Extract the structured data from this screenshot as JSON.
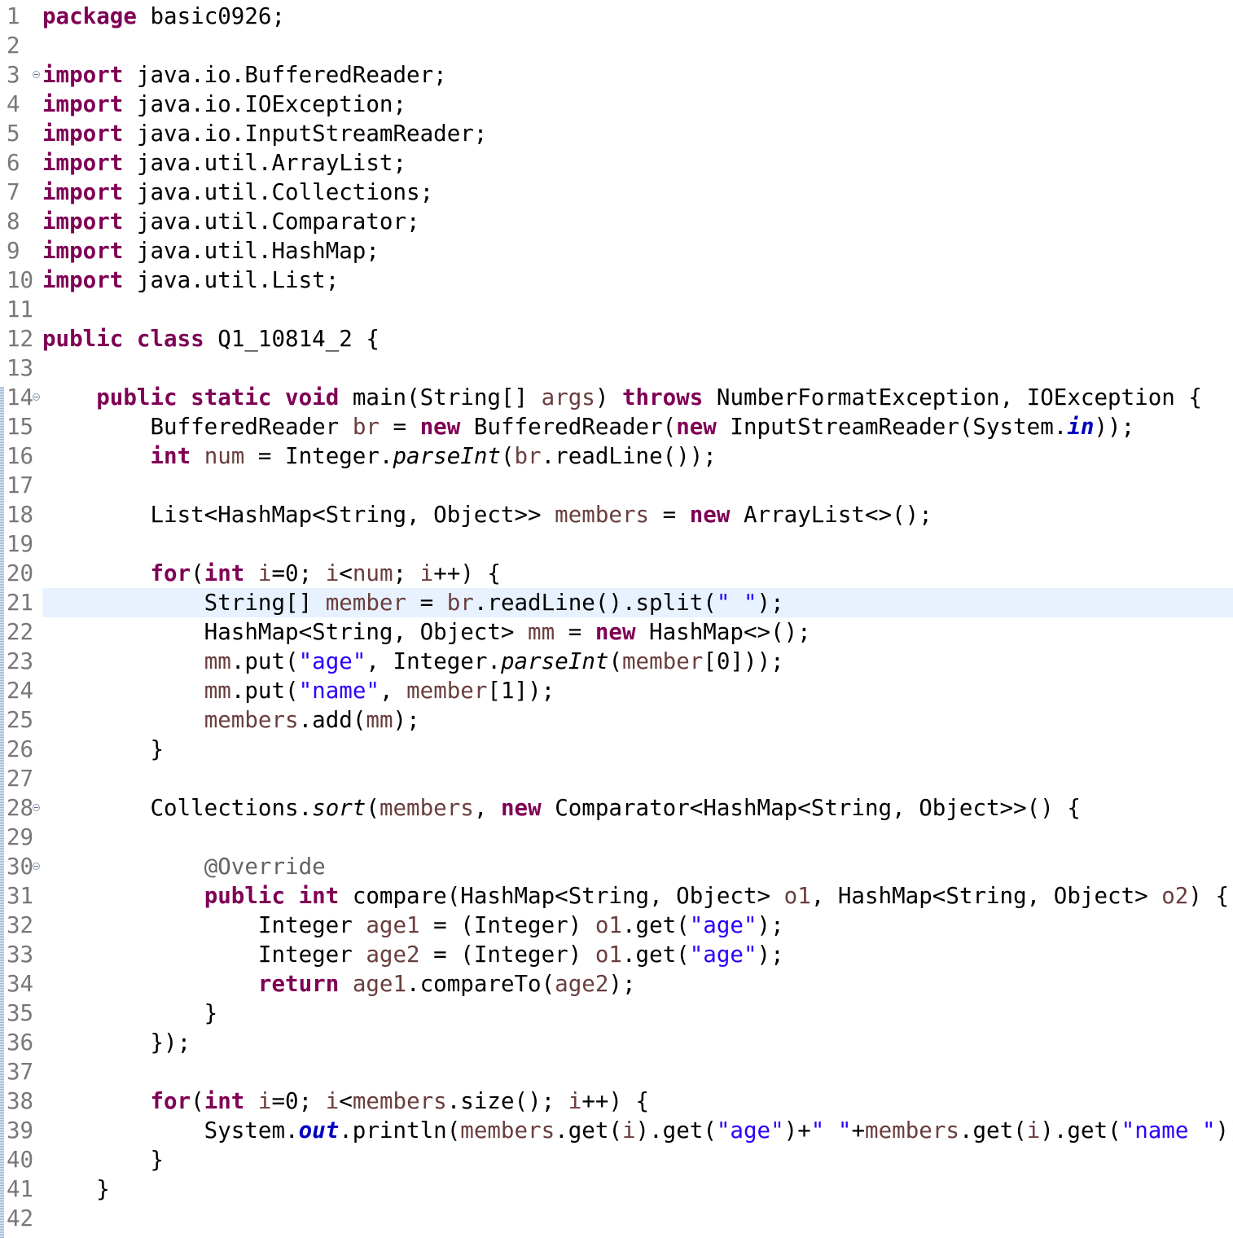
{
  "editor": {
    "current_line": 21,
    "lines": [
      {
        "n": "1",
        "fold": false,
        "tokens": [
          {
            "t": "package",
            "c": "kw"
          },
          {
            "t": " basic0926;"
          }
        ]
      },
      {
        "n": "2",
        "fold": false,
        "tokens": []
      },
      {
        "n": "3",
        "fold": true,
        "tokens": [
          {
            "t": "import",
            "c": "kw"
          },
          {
            "t": " java.io.BufferedReader;"
          }
        ]
      },
      {
        "n": "4",
        "fold": false,
        "tokens": [
          {
            "t": "import",
            "c": "kw"
          },
          {
            "t": " java.io.IOException;"
          }
        ]
      },
      {
        "n": "5",
        "fold": false,
        "tokens": [
          {
            "t": "import",
            "c": "kw"
          },
          {
            "t": " java.io.InputStreamReader;"
          }
        ]
      },
      {
        "n": "6",
        "fold": false,
        "tokens": [
          {
            "t": "import",
            "c": "kw"
          },
          {
            "t": " java.util.ArrayList;"
          }
        ]
      },
      {
        "n": "7",
        "fold": false,
        "tokens": [
          {
            "t": "import",
            "c": "kw"
          },
          {
            "t": " java.util.Collections;"
          }
        ]
      },
      {
        "n": "8",
        "fold": false,
        "tokens": [
          {
            "t": "import",
            "c": "kw"
          },
          {
            "t": " java.util.Comparator;"
          }
        ]
      },
      {
        "n": "9",
        "fold": false,
        "tokens": [
          {
            "t": "import",
            "c": "kw"
          },
          {
            "t": " java.util.HashMap;"
          }
        ]
      },
      {
        "n": "10",
        "fold": false,
        "tokens": [
          {
            "t": "import",
            "c": "kw"
          },
          {
            "t": " java.util.List;"
          }
        ]
      },
      {
        "n": "11",
        "fold": false,
        "tokens": []
      },
      {
        "n": "12",
        "fold": false,
        "tokens": [
          {
            "t": "public",
            "c": "kw"
          },
          {
            "t": " "
          },
          {
            "t": "class",
            "c": "kw"
          },
          {
            "t": " Q1_10814_2 {"
          }
        ]
      },
      {
        "n": "13",
        "fold": false,
        "tokens": []
      },
      {
        "n": "14",
        "fold": true,
        "tokens": [
          {
            "t": "    "
          },
          {
            "t": "public",
            "c": "kw"
          },
          {
            "t": " "
          },
          {
            "t": "static",
            "c": "kw"
          },
          {
            "t": " "
          },
          {
            "t": "void",
            "c": "kw"
          },
          {
            "t": " main(String[] "
          },
          {
            "t": "args",
            "c": "var"
          },
          {
            "t": ") "
          },
          {
            "t": "throws",
            "c": "kw"
          },
          {
            "t": " NumberFormatException, IOException {"
          }
        ]
      },
      {
        "n": "15",
        "fold": false,
        "tokens": [
          {
            "t": "        BufferedReader "
          },
          {
            "t": "br",
            "c": "var"
          },
          {
            "t": " = "
          },
          {
            "t": "new",
            "c": "kw"
          },
          {
            "t": " BufferedReader("
          },
          {
            "t": "new",
            "c": "kw"
          },
          {
            "t": " InputStreamReader(System."
          },
          {
            "t": "in",
            "c": "fld"
          },
          {
            "t": "));"
          }
        ]
      },
      {
        "n": "16",
        "fold": false,
        "tokens": [
          {
            "t": "        "
          },
          {
            "t": "int",
            "c": "kw"
          },
          {
            "t": " "
          },
          {
            "t": "num",
            "c": "var"
          },
          {
            "t": " = Integer."
          },
          {
            "t": "parseInt",
            "c": "it"
          },
          {
            "t": "("
          },
          {
            "t": "br",
            "c": "var"
          },
          {
            "t": ".readLine());"
          }
        ]
      },
      {
        "n": "17",
        "fold": false,
        "tokens": []
      },
      {
        "n": "18",
        "fold": false,
        "tokens": [
          {
            "t": "        List<HashMap<String, Object>> "
          },
          {
            "t": "members",
            "c": "var"
          },
          {
            "t": " = "
          },
          {
            "t": "new",
            "c": "kw"
          },
          {
            "t": " ArrayList<>();"
          }
        ]
      },
      {
        "n": "19",
        "fold": false,
        "tokens": []
      },
      {
        "n": "20",
        "fold": false,
        "tokens": [
          {
            "t": "        "
          },
          {
            "t": "for",
            "c": "kw"
          },
          {
            "t": "("
          },
          {
            "t": "int",
            "c": "kw"
          },
          {
            "t": " "
          },
          {
            "t": "i",
            "c": "var"
          },
          {
            "t": "=0; "
          },
          {
            "t": "i",
            "c": "var"
          },
          {
            "t": "<"
          },
          {
            "t": "num",
            "c": "var"
          },
          {
            "t": "; "
          },
          {
            "t": "i",
            "c": "var"
          },
          {
            "t": "++) {"
          }
        ]
      },
      {
        "n": "21",
        "fold": false,
        "tokens": [
          {
            "t": "            String[] "
          },
          {
            "t": "member",
            "c": "var"
          },
          {
            "t": " = "
          },
          {
            "t": "br",
            "c": "var"
          },
          {
            "t": ".readLine().split("
          },
          {
            "t": "\" \"",
            "c": "str"
          },
          {
            "t": ");"
          }
        ]
      },
      {
        "n": "22",
        "fold": false,
        "tokens": [
          {
            "t": "            HashMap<String, Object> "
          },
          {
            "t": "mm",
            "c": "var"
          },
          {
            "t": " = "
          },
          {
            "t": "new",
            "c": "kw"
          },
          {
            "t": " HashMap<>();"
          }
        ]
      },
      {
        "n": "23",
        "fold": false,
        "tokens": [
          {
            "t": "            "
          },
          {
            "t": "mm",
            "c": "var"
          },
          {
            "t": ".put("
          },
          {
            "t": "\"age\"",
            "c": "str"
          },
          {
            "t": ", Integer."
          },
          {
            "t": "parseInt",
            "c": "it"
          },
          {
            "t": "("
          },
          {
            "t": "member",
            "c": "var"
          },
          {
            "t": "[0]));"
          }
        ]
      },
      {
        "n": "24",
        "fold": false,
        "tokens": [
          {
            "t": "            "
          },
          {
            "t": "mm",
            "c": "var"
          },
          {
            "t": ".put("
          },
          {
            "t": "\"name\"",
            "c": "str"
          },
          {
            "t": ", "
          },
          {
            "t": "member",
            "c": "var"
          },
          {
            "t": "[1]);"
          }
        ]
      },
      {
        "n": "25",
        "fold": false,
        "tokens": [
          {
            "t": "            "
          },
          {
            "t": "members",
            "c": "var"
          },
          {
            "t": ".add("
          },
          {
            "t": "mm",
            "c": "var"
          },
          {
            "t": ");"
          }
        ]
      },
      {
        "n": "26",
        "fold": false,
        "tokens": [
          {
            "t": "        }"
          }
        ]
      },
      {
        "n": "27",
        "fold": false,
        "tokens": []
      },
      {
        "n": "28",
        "fold": true,
        "tokens": [
          {
            "t": "        Collections."
          },
          {
            "t": "sort",
            "c": "it"
          },
          {
            "t": "("
          },
          {
            "t": "members",
            "c": "var"
          },
          {
            "t": ", "
          },
          {
            "t": "new",
            "c": "kw"
          },
          {
            "t": " Comparator<HashMap<String, Object>>() {"
          }
        ]
      },
      {
        "n": "29",
        "fold": false,
        "tokens": []
      },
      {
        "n": "30",
        "fold": true,
        "tokens": [
          {
            "t": "            "
          },
          {
            "t": "@Override",
            "c": "ann"
          }
        ]
      },
      {
        "n": "31",
        "fold": false,
        "tokens": [
          {
            "t": "            "
          },
          {
            "t": "public",
            "c": "kw"
          },
          {
            "t": " "
          },
          {
            "t": "int",
            "c": "kw"
          },
          {
            "t": " compare(HashMap<String, Object> "
          },
          {
            "t": "o1",
            "c": "var"
          },
          {
            "t": ", HashMap<String, Object> "
          },
          {
            "t": "o2",
            "c": "var"
          },
          {
            "t": ") {"
          }
        ]
      },
      {
        "n": "32",
        "fold": false,
        "tokens": [
          {
            "t": "                Integer "
          },
          {
            "t": "age1",
            "c": "var"
          },
          {
            "t": " = (Integer) "
          },
          {
            "t": "o1",
            "c": "var"
          },
          {
            "t": ".get("
          },
          {
            "t": "\"age\"",
            "c": "str"
          },
          {
            "t": ");"
          }
        ]
      },
      {
        "n": "33",
        "fold": false,
        "tokens": [
          {
            "t": "                Integer "
          },
          {
            "t": "age2",
            "c": "var"
          },
          {
            "t": " = (Integer) "
          },
          {
            "t": "o1",
            "c": "var"
          },
          {
            "t": ".get("
          },
          {
            "t": "\"age\"",
            "c": "str"
          },
          {
            "t": ");"
          }
        ]
      },
      {
        "n": "34",
        "fold": false,
        "tokens": [
          {
            "t": "                "
          },
          {
            "t": "return",
            "c": "kw"
          },
          {
            "t": " "
          },
          {
            "t": "age1",
            "c": "var"
          },
          {
            "t": ".compareTo("
          },
          {
            "t": "age2",
            "c": "var"
          },
          {
            "t": ");"
          }
        ]
      },
      {
        "n": "35",
        "fold": false,
        "tokens": [
          {
            "t": "            }"
          }
        ]
      },
      {
        "n": "36",
        "fold": false,
        "tokens": [
          {
            "t": "        });"
          }
        ]
      },
      {
        "n": "37",
        "fold": false,
        "tokens": []
      },
      {
        "n": "38",
        "fold": false,
        "tokens": [
          {
            "t": "        "
          },
          {
            "t": "for",
            "c": "kw"
          },
          {
            "t": "("
          },
          {
            "t": "int",
            "c": "kw"
          },
          {
            "t": " "
          },
          {
            "t": "i",
            "c": "var"
          },
          {
            "t": "=0; "
          },
          {
            "t": "i",
            "c": "var"
          },
          {
            "t": "<"
          },
          {
            "t": "members",
            "c": "var"
          },
          {
            "t": ".size(); "
          },
          {
            "t": "i",
            "c": "var"
          },
          {
            "t": "++) {"
          }
        ]
      },
      {
        "n": "39",
        "fold": false,
        "tokens": [
          {
            "t": "            System."
          },
          {
            "t": "out",
            "c": "fld"
          },
          {
            "t": ".println("
          },
          {
            "t": "members",
            "c": "var"
          },
          {
            "t": ".get("
          },
          {
            "t": "i",
            "c": "var"
          },
          {
            "t": ").get("
          },
          {
            "t": "\"age\"",
            "c": "str"
          },
          {
            "t": ")+"
          },
          {
            "t": "\" \"",
            "c": "str"
          },
          {
            "t": "+"
          },
          {
            "t": "members",
            "c": "var"
          },
          {
            "t": ".get("
          },
          {
            "t": "i",
            "c": "var"
          },
          {
            "t": ").get("
          },
          {
            "t": "\"name \"",
            "c": "str"
          },
          {
            "t": "));"
          }
        ]
      },
      {
        "n": "40",
        "fold": false,
        "tokens": [
          {
            "t": "        }"
          }
        ]
      },
      {
        "n": "41",
        "fold": false,
        "tokens": [
          {
            "t": "    }"
          }
        ]
      },
      {
        "n": "42",
        "fold": false,
        "tokens": []
      }
    ]
  }
}
